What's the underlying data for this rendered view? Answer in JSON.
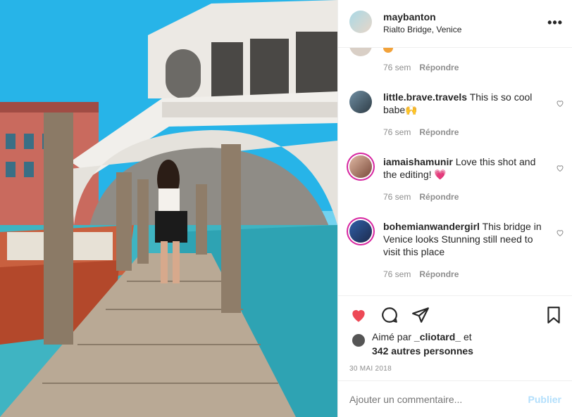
{
  "post": {
    "username": "maybanton",
    "location": "Rialto Bridge, Venice",
    "more_icon": "more-horizontal-icon"
  },
  "comments": [
    {
      "username": "",
      "text": "",
      "time": "76 sem",
      "reply": "Répondre"
    },
    {
      "username": "little.brave.travels",
      "text": "This is so cool babe🙌",
      "time": "76 sem",
      "reply": "Répondre"
    },
    {
      "username": "iamaishamunir",
      "text": "Love this shot and the editing! 💗",
      "time": "76 sem",
      "reply": "Répondre"
    },
    {
      "username": "bohemianwandergirl",
      "text": "This bridge in Venice looks Stunning still need to visit this place",
      "time": "76 sem",
      "reply": "Répondre"
    }
  ],
  "likes": {
    "prefix": "Aimé par",
    "user": "_cliotard_",
    "suffix": "et",
    "others": "342 autres personnes"
  },
  "date": "30 MAI 2018",
  "add_comment": {
    "placeholder": "Ajouter un commentaire...",
    "publish": "Publier"
  },
  "colors": {
    "like_red": "#ed4956",
    "publish_blue": "#b2dffc",
    "muted": "#8e8e8e"
  }
}
